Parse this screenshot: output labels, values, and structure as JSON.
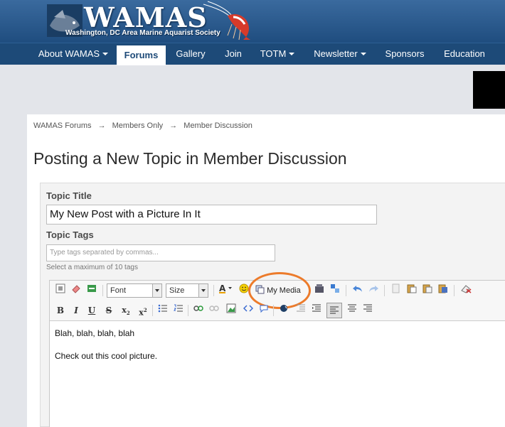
{
  "header": {
    "site_title": "WAMAS",
    "site_subtitle": "Washington, DC Area Marine Aquarist Society"
  },
  "nav": {
    "items": [
      {
        "label": "About WAMAS",
        "dropdown": true
      },
      {
        "label": "Forums",
        "active": true
      },
      {
        "label": "Gallery"
      },
      {
        "label": "Join"
      },
      {
        "label": "TOTM",
        "dropdown": true
      },
      {
        "label": "Newsletter",
        "dropdown": true
      },
      {
        "label": "Sponsors"
      },
      {
        "label": "Education"
      }
    ]
  },
  "breadcrumb": {
    "items": [
      "WAMAS Forums",
      "Members Only",
      "Member Discussion"
    ],
    "separator": "→"
  },
  "page_title": "Posting a New Topic in Member Discussion",
  "form": {
    "topic_title_label": "Topic Title",
    "topic_title_value": "My New Post with a Picture In It",
    "topic_tags_label": "Topic Tags",
    "topic_tags_placeholder": "Type tags separated by commas...",
    "tags_hint": "Select a maximum of 10 tags"
  },
  "editor": {
    "font_select": "Font",
    "size_select": "Size",
    "my_media_label": "My Media",
    "body_lines": [
      "Blah, blah, blah, blah",
      "Check out this cool picture."
    ],
    "highlight_color": "#ec7b2b"
  }
}
